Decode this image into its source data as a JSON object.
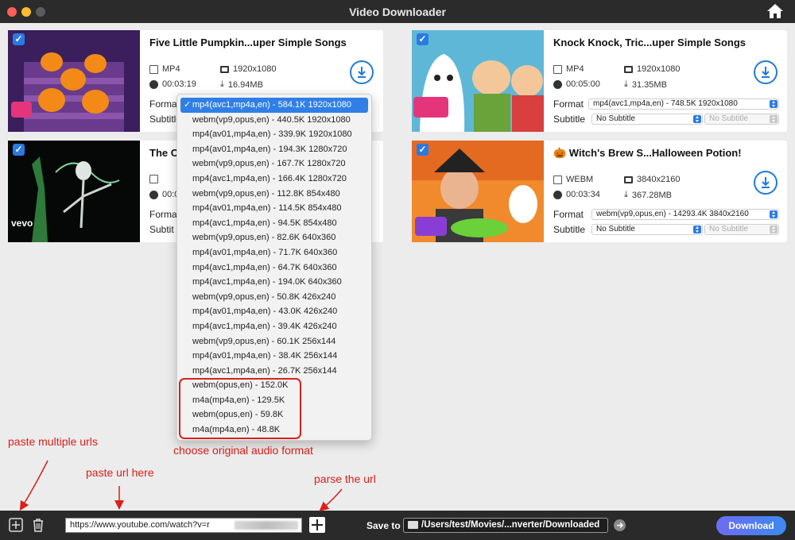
{
  "window": {
    "title": "Video Downloader"
  },
  "cards": [
    {
      "title": "Five Little Pumpkin...uper Simple Songs",
      "format": "MP4",
      "resolution": "1920x1080",
      "duration": "00:03:19",
      "size": "16.94MB",
      "format_label": "Format",
      "subtitle_label": "Subtitle",
      "format_value": "mp4(avc1,mp4a,en) - 584.1K 1920x1080",
      "subtitle_value": "No Subtitle",
      "subtitle2_value": "No Subtitle",
      "thumb_logo": "SUPER SIMPLE"
    },
    {
      "title": "Knock Knock, Tric...uper Simple Songs",
      "format": "MP4",
      "resolution": "1920x1080",
      "duration": "00:05:00",
      "size": "31.35MB",
      "format_label": "Format",
      "subtitle_label": "Subtitle",
      "format_value": "mp4(avc1,mp4a,en) - 748.5K 1920x1080",
      "subtitle_value": "No Subtitle",
      "subtitle2_value": "No Subtitle",
      "thumb_logo": "SUPER SIMPLE"
    },
    {
      "title": "The C",
      "format": "",
      "resolution": "",
      "duration": "00:0",
      "size": "",
      "format_label": "Forma",
      "subtitle_label": "Subtit",
      "thumb_logo": "vevo"
    },
    {
      "title": "🎃 Witch's Brew S...Halloween Potion!",
      "format": "WEBM",
      "resolution": "3840x2160",
      "duration": "00:03:34",
      "size": "367.28MB",
      "format_label": "Format",
      "subtitle_label": "Subtitle",
      "format_value": "webm(vp9,opus,en) - 14293.4K 3840x2160",
      "subtitle_value": "No Subtitle",
      "subtitle2_value": "No Subtitle",
      "thumb_logo": "MOOSE CLUMPS"
    }
  ],
  "dropdown": {
    "selected_index": 0,
    "options": [
      "mp4(avc1,mp4a,en) - 584.1K 1920x1080",
      "webm(vp9,opus,en) - 440.5K 1920x1080",
      "mp4(av01,mp4a,en) - 339.9K 1920x1080",
      "mp4(av01,mp4a,en) - 194.3K 1280x720",
      "webm(vp9,opus,en) - 167.7K 1280x720",
      "mp4(avc1,mp4a,en) - 166.4K 1280x720",
      "webm(vp9,opus,en) - 112.8K 854x480",
      "mp4(av01,mp4a,en) - 114.5K 854x480",
      "mp4(avc1,mp4a,en) - 94.5K 854x480",
      "webm(vp9,opus,en) - 82.6K 640x360",
      "mp4(av01,mp4a,en) - 71.7K 640x360",
      "mp4(avc1,mp4a,en) - 64.7K 640x360",
      "mp4(avc1,mp4a,en) - 194.0K 640x360",
      "webm(vp9,opus,en) - 50.8K 426x240",
      "mp4(av01,mp4a,en) - 43.0K 426x240",
      "mp4(avc1,mp4a,en) - 39.4K 426x240",
      "webm(vp9,opus,en) - 60.1K 256x144",
      "mp4(av01,mp4a,en) - 38.4K 256x144",
      "mp4(avc1,mp4a,en) - 26.7K 256x144",
      "webm(opus,en) - 152.0K",
      "m4a(mp4a,en) - 129.5K",
      "webm(opus,en) - 59.8K",
      "m4a(mp4a,en) - 48.8K"
    ]
  },
  "annotations": {
    "audio": "choose original audio format",
    "multiple": "paste multiple urls",
    "paste": "paste url here",
    "parse": "parse the url",
    "color": "#d9201b"
  },
  "bottom": {
    "url_value": "https://www.youtube.com/watch?v=r",
    "save_to_label": "Save to",
    "save_path": "/Users/test/Movies/...nverter/Downloaded",
    "download_label": "Download"
  },
  "colors": {
    "accent": "#2a7ae4",
    "annotation": "#d9201b",
    "download_gradient_start": "#6f6cf2",
    "download_gradient_end": "#3b8af0"
  }
}
